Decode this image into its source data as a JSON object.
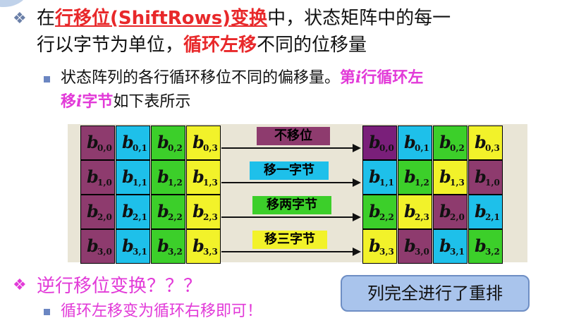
{
  "heading": {
    "part1": "在",
    "part2_red": "行移位(ShiftRows)变换",
    "part3": "中，状态矩阵中的每一",
    "line2_part1": "行以字节为单位，",
    "line2_red": "循环左移",
    "line2_part2": "不同的位移量"
  },
  "sub_bullet": {
    "part1": "状态阵列的各行循环移位不同的偏移量。",
    "magenta1": "第",
    "magenta_i": "i",
    "magenta2": "行循环左",
    "line2_magenta1": "移",
    "line2_magenta_i": "i",
    "line2_magenta2": "字节",
    "line2_part2": "如下表所示"
  },
  "diagram": {
    "letter": "b",
    "left_matrix": [
      [
        "0,0",
        "0,1",
        "0,2",
        "0,3"
      ],
      [
        "1,0",
        "1,1",
        "1,2",
        "1,3"
      ],
      [
        "2,0",
        "2,1",
        "2,2",
        "2,3"
      ],
      [
        "3,0",
        "3,1",
        "3,2",
        "3,3"
      ]
    ],
    "right_matrix": [
      [
        "0,0",
        "0,1",
        "0,2",
        "0,3"
      ],
      [
        "1,1",
        "1,2",
        "1,3",
        "1,0"
      ],
      [
        "2,2",
        "2,3",
        "2,0",
        "2,1"
      ],
      [
        "3,3",
        "3,0",
        "3,1",
        "3,2"
      ]
    ],
    "shift_labels": [
      "不移位",
      "移一字节",
      "移两字节",
      "移三字节"
    ],
    "colors": {
      "col0": "#8e3b6e",
      "col1": "#1ec0ea",
      "col2": "#3ccf2a",
      "col3": "#f2f22a",
      "purple_dark": "#7a1f7a",
      "label0": "#8e3b6e",
      "label1": "#1ec0ea",
      "label2": "#3ccf2a",
      "label3": "#f2f22a"
    }
  },
  "bottom": {
    "question": "逆行移位变换？？？",
    "answer": "循环左移变为循环右移即可！",
    "box_text": "列完全进行了重排"
  }
}
